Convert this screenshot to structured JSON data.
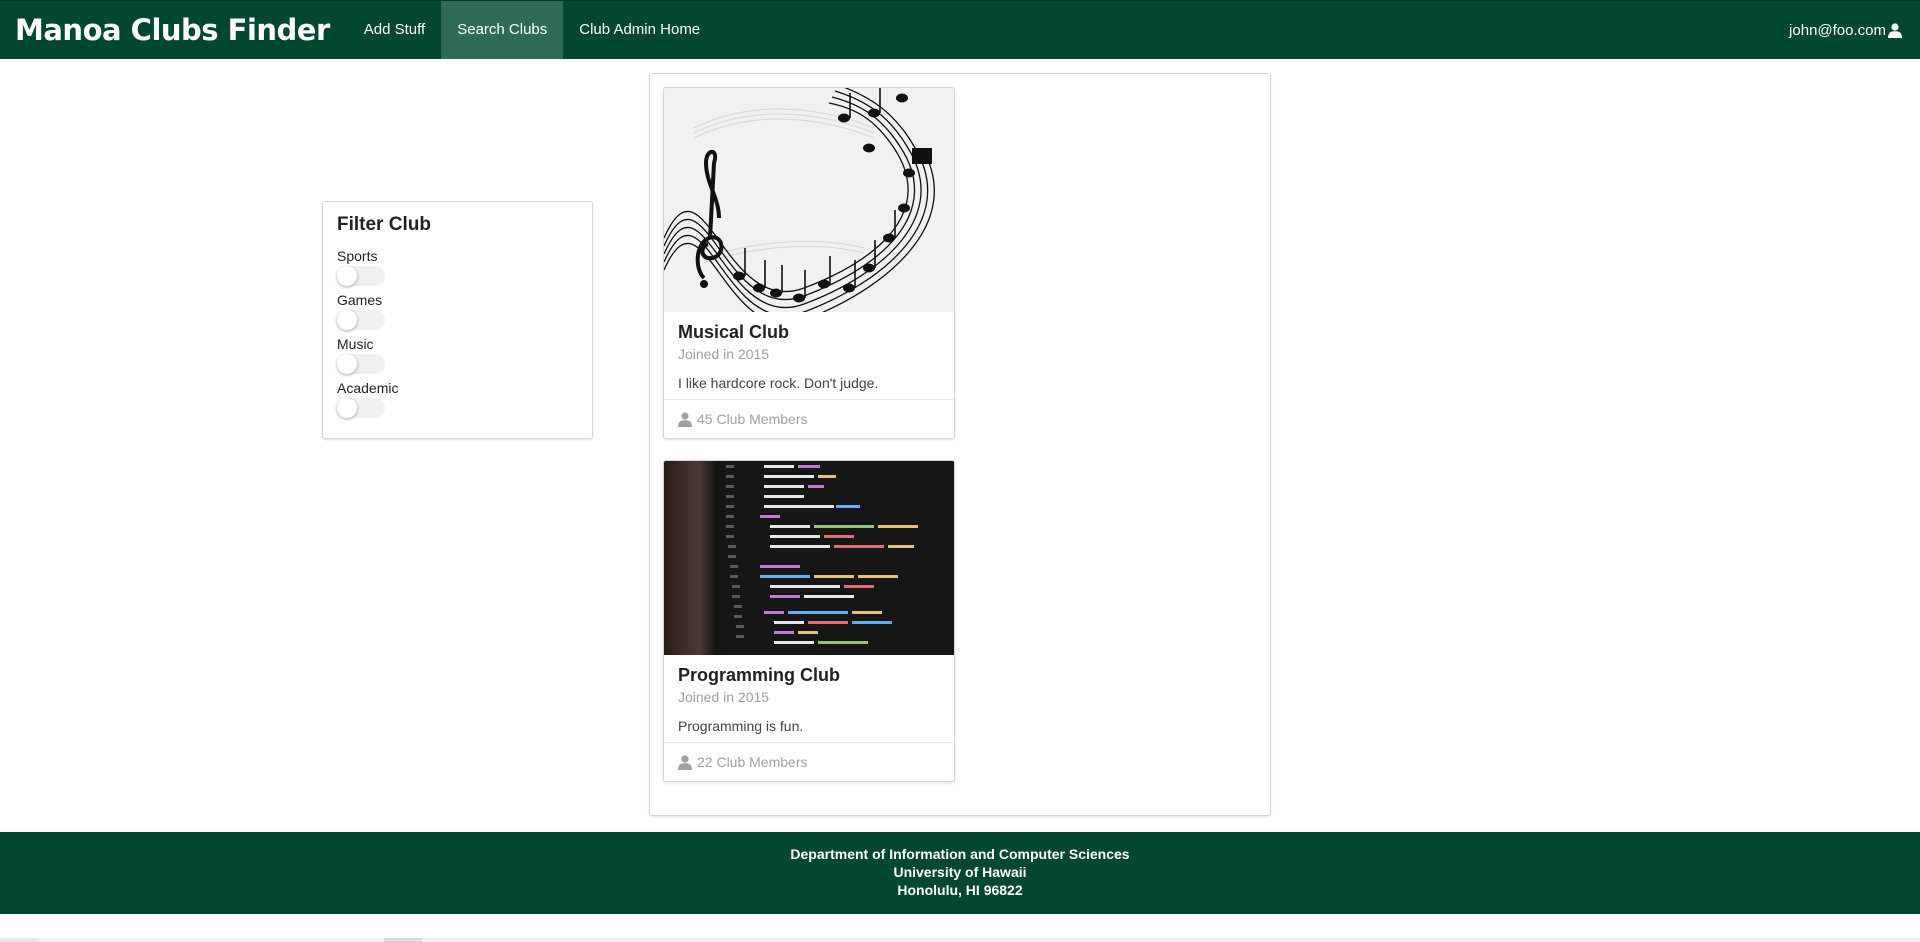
{
  "navbar": {
    "brand": "Manoa Clubs Finder",
    "items": [
      {
        "label": "Add Stuff",
        "active": false
      },
      {
        "label": "Search Clubs",
        "active": true
      },
      {
        "label": "Club Admin Home",
        "active": false
      }
    ],
    "user_email": "john@foo.com",
    "user_icon": "user-icon"
  },
  "filter": {
    "title": "Filter Club",
    "options": [
      {
        "label": "Sports",
        "on": false
      },
      {
        "label": "Games",
        "on": false
      },
      {
        "label": "Music",
        "on": false
      },
      {
        "label": "Academic",
        "on": false
      }
    ]
  },
  "clubs": [
    {
      "title": "Musical Club",
      "meta": "Joined in 2015",
      "description": "I like hardcore rock. Don't judge.",
      "members": "45 Club Members",
      "image": "music-notes-image"
    },
    {
      "title": "Programming Club",
      "meta": "Joined in 2015",
      "description": "Programming is fun.",
      "members": "22 Club Members",
      "image": "code-screen-image"
    }
  ],
  "footer": {
    "line1": "Department of Information and Computer Sciences",
    "line2": "University of Hawaii",
    "line3": "Honolulu, HI 96822"
  },
  "colors": {
    "brand_green": "#024731",
    "active_nav": "#2d6b57"
  }
}
